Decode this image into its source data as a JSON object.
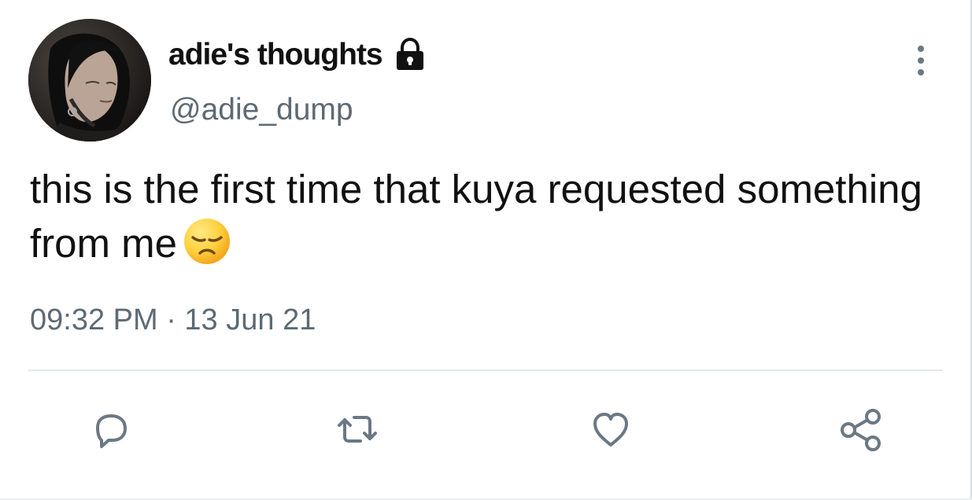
{
  "tweet": {
    "display_name": "adie's thoughts",
    "handle": "@adie_dump",
    "text": "this is the first time that kuya requested something from me",
    "emoji": "disappointed-face",
    "timestamp": "09:32 PM · 13 Jun 21",
    "protected_account": true
  },
  "actions": {
    "reply": "reply-icon",
    "retweet": "retweet-icon",
    "like": "heart-icon",
    "share": "share-icon"
  },
  "colors": {
    "text_primary": "#111111",
    "text_secondary": "#5d6a74",
    "icon": "#6b7884",
    "divider": "#e4e7ea",
    "background": "#ffffff"
  }
}
